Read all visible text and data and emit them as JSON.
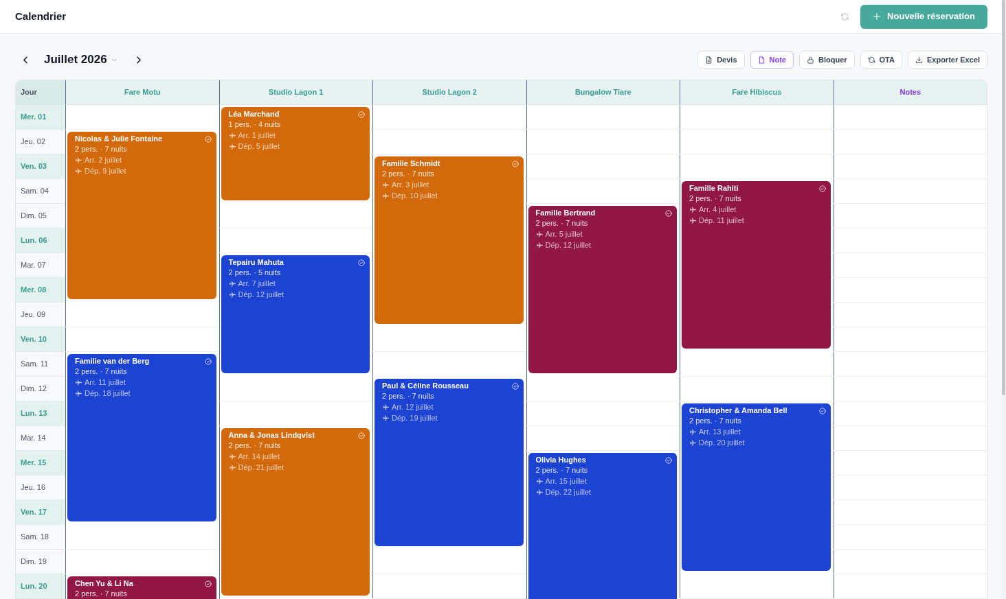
{
  "header": {
    "title": "Calendrier",
    "new_button": "Nouvelle réservation"
  },
  "toolbar": {
    "month": "Juillet 2026",
    "actions": [
      {
        "label": "Devis",
        "kind": "plain"
      },
      {
        "label": "Note",
        "kind": "accent"
      },
      {
        "label": "Bloquer",
        "kind": "plain"
      },
      {
        "label": "OTA",
        "kind": "plain"
      },
      {
        "label": "Exporter Excel",
        "kind": "plain"
      }
    ]
  },
  "calendar": {
    "corner": "Jour",
    "days": [
      {
        "label": "Mer. 01",
        "highlighted": true
      },
      {
        "label": "Jeu. 02",
        "highlighted": false
      },
      {
        "label": "Ven. 03",
        "highlighted": true
      },
      {
        "label": "Sam. 04",
        "highlighted": false
      },
      {
        "label": "Dim. 05",
        "highlighted": false
      },
      {
        "label": "Lun. 06",
        "highlighted": true
      },
      {
        "label": "Mar. 07",
        "highlighted": false
      },
      {
        "label": "Mer. 08",
        "highlighted": true
      },
      {
        "label": "Jeu. 09",
        "highlighted": false
      },
      {
        "label": "Ven. 10",
        "highlighted": true
      },
      {
        "label": "Sam. 11",
        "highlighted": false
      },
      {
        "label": "Dim. 12",
        "highlighted": false
      },
      {
        "label": "Lun. 13",
        "highlighted": true
      },
      {
        "label": "Mar. 14",
        "highlighted": false
      },
      {
        "label": "Mer. 15",
        "highlighted": true
      },
      {
        "label": "Jeu. 16",
        "highlighted": false
      },
      {
        "label": "Ven. 17",
        "highlighted": true
      },
      {
        "label": "Sam. 18",
        "highlighted": false
      },
      {
        "label": "Dim. 19",
        "highlighted": false
      },
      {
        "label": "Lun. 20",
        "highlighted": true
      }
    ],
    "columns": [
      {
        "name": "Fare Motu",
        "kind": "room",
        "bookings": [
          {
            "guest": "Nicolas & Julie Fontaine",
            "summary": "2 pers. · 7 nuits",
            "arrival": "Arr. 2 juillet",
            "departure": "Dép. 9 juillet",
            "color": "#d2690b",
            "confirmed": true
          },
          {
            "guest": "Familie van der Berg",
            "summary": "2 pers. · 7 nuits",
            "arrival": "Arr. 11 juillet",
            "departure": "Dép. 18 juillet",
            "color": "#1d43d3",
            "confirmed": true
          },
          {
            "guest": "Chen Yu & Li Na",
            "summary": "2 pers. · 7 nuits",
            "color": "#911845",
            "confirmed": true
          }
        ]
      },
      {
        "name": "Studio Lagon 1",
        "kind": "room",
        "bookings": [
          {
            "guest": "Léa Marchand",
            "summary": "1 pers. · 4 nuits",
            "arrival": "Arr. 1 juillet",
            "departure": "Dép. 5 juillet",
            "color": "#d2690b",
            "confirmed": true
          },
          {
            "guest": "Tepairu Mahuta",
            "summary": "2 pers. · 5 nuits",
            "arrival": "Arr. 7 juillet",
            "departure": "Dép. 12 juillet",
            "color": "#1d43d3",
            "confirmed": true
          },
          {
            "guest": "Anna & Jonas Lindqvist",
            "summary": "2 pers. · 7 nuits",
            "arrival": "Arr. 14 juillet",
            "departure": "Dép. 21 juillet",
            "color": "#d2690b",
            "confirmed": true
          }
        ]
      },
      {
        "name": "Studio Lagon 2",
        "kind": "room",
        "bookings": [
          {
            "guest": "Familie Schmidt",
            "summary": "2 pers. · 7 nuits",
            "arrival": "Arr. 3 juillet",
            "departure": "Dép. 10 juillet",
            "color": "#d2690b",
            "confirmed": true
          },
          {
            "guest": "Paul & Céline Rousseau",
            "summary": "2 pers. · 7 nuits",
            "arrival": "Arr. 12 juillet",
            "departure": "Dép. 19 juillet",
            "color": "#1d43d3",
            "confirmed": true
          }
        ]
      },
      {
        "name": "Bungalow Tiare",
        "kind": "room",
        "bookings": [
          {
            "guest": "Famille Bertrand",
            "summary": "2 pers. · 7 nuits",
            "arrival": "Arr. 5 juillet",
            "departure": "Dép. 12 juillet",
            "color": "#911845",
            "confirmed": true
          },
          {
            "guest": "Olivia Hughes",
            "summary": "2 pers. · 7 nuits",
            "arrival": "Arr. 15 juillet",
            "departure": "Dép. 22 juillet",
            "color": "#1d43d3",
            "confirmed": true
          }
        ]
      },
      {
        "name": "Fare Hibiscus",
        "kind": "room",
        "bookings": [
          {
            "guest": "Famille Rahiti",
            "summary": "2 pers. · 7 nuits",
            "arrival": "Arr. 4 juillet",
            "departure": "Dép. 11 juillet",
            "color": "#911845",
            "confirmed": true
          },
          {
            "guest": "Christopher & Amanda Bell",
            "summary": "2 pers. · 7 nuits",
            "arrival": "Arr. 13 juillet",
            "departure": "Dép. 20 juillet",
            "color": "#1d43d3",
            "confirmed": true
          }
        ]
      },
      {
        "name": "Notes",
        "kind": "notes"
      }
    ]
  }
}
